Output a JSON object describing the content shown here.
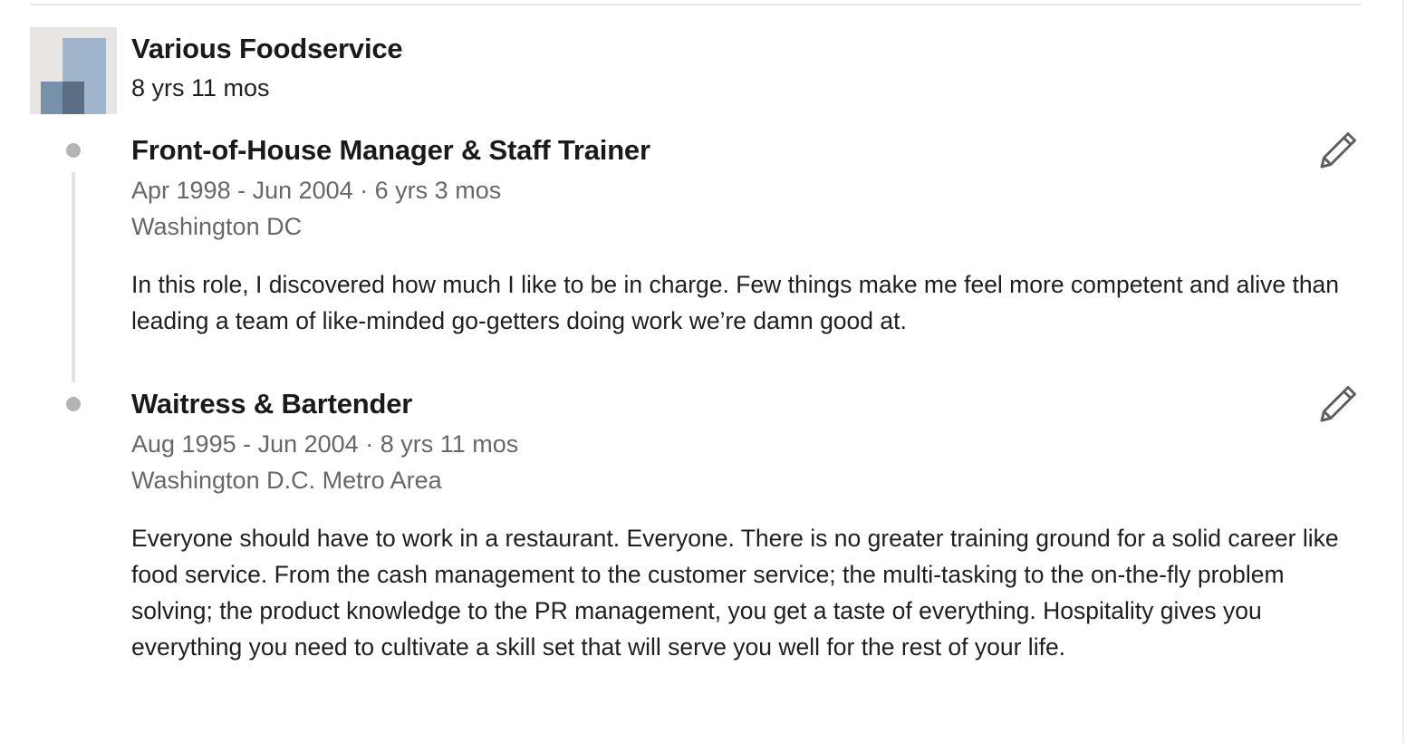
{
  "company": {
    "name": "Various Foodservice",
    "duration": "8 yrs 11 mos",
    "logo_icon": "company-logo-placeholder",
    "logo_colors": [
      "#e9e5e2",
      "#9fb5cc",
      "#7891ab",
      "#5b6e83"
    ]
  },
  "positions": [
    {
      "title": "Front-of-House Manager & Staff Trainer",
      "dates": "Apr 1998 - Jun 2004 · 6 yrs 3 mos",
      "location": "Washington DC",
      "description": "In this role, I discovered how much I like to be in charge. Few things make me feel more competent and alive than leading a team of like-minded go-getters doing work we’re damn good at.",
      "edit_icon": "pencil-icon"
    },
    {
      "title": "Waitress & Bartender",
      "dates": "Aug 1995 - Jun 2004 · 8 yrs 11 mos",
      "location": "Washington D.C. Metro Area",
      "description": "Everyone should have to work in a restaurant. Everyone. There is no greater training ground for a solid career like food service. From the cash management to the customer service; the multi-tasking to the on-the-fly problem solving; the product knowledge to the PR management, you get a taste of everything. Hospitality gives you everything you need to cultivate a skill set that will serve you well for the rest of your life.",
      "edit_icon": "pencil-icon"
    }
  ],
  "colors": {
    "heading": "#1a1a1a",
    "secondary_text": "#676767",
    "timeline_dot": "#b4b4b4",
    "timeline_line": "#e3e3e3",
    "icon": "#5f5f5f"
  }
}
